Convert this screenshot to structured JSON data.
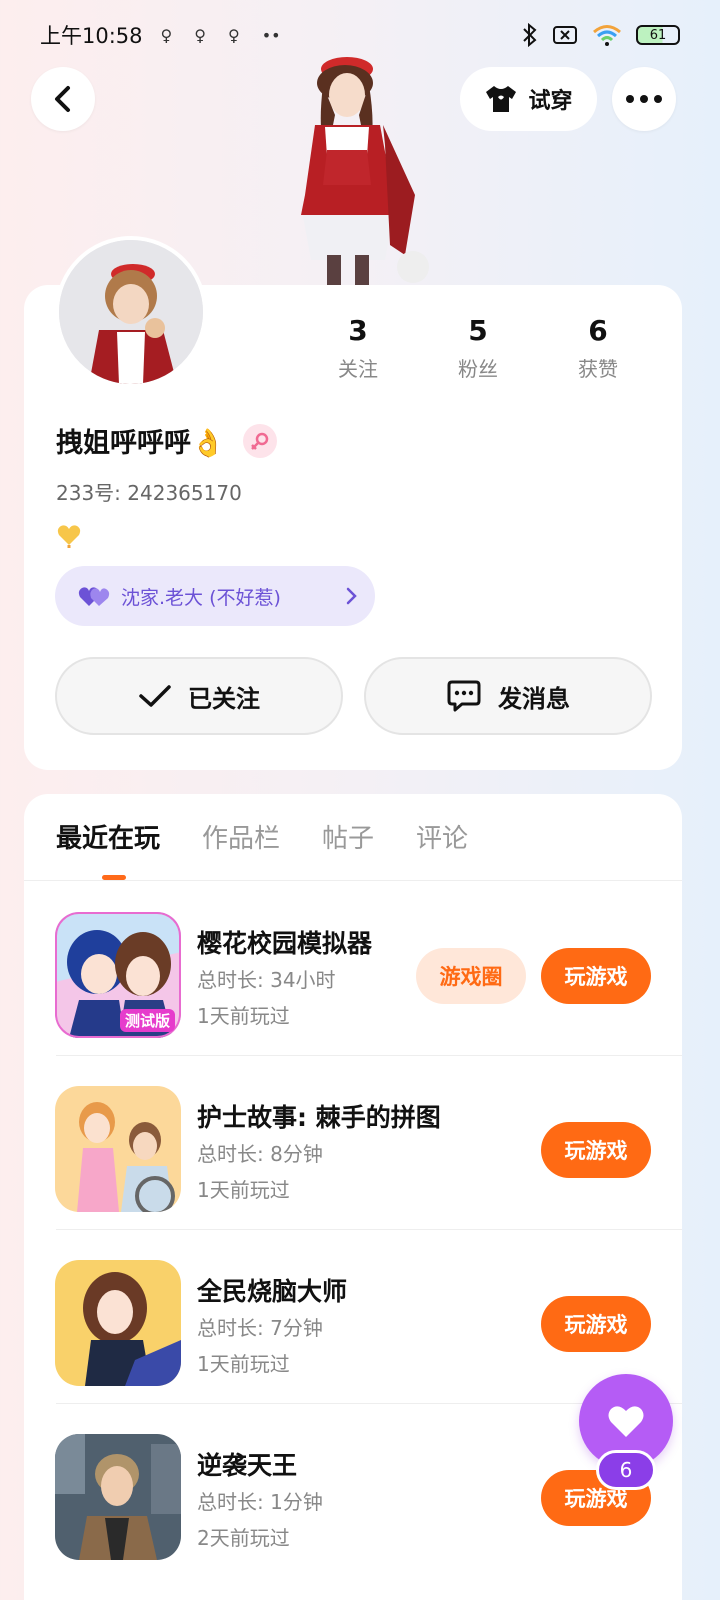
{
  "status_bar": {
    "time": "上午10:58",
    "notif_dots": "••",
    "battery": "61"
  },
  "header": {
    "tryon_label": "试穿"
  },
  "profile": {
    "stats": [
      {
        "count": "3",
        "label": "关注"
      },
      {
        "count": "5",
        "label": "粉丝"
      },
      {
        "count": "6",
        "label": "获赞"
      }
    ],
    "username": "拽姐呼呼呼👌",
    "uid": "233号: 242365170",
    "group_name": "沈家.老大 (不好惹)",
    "follow_label": "已关注",
    "message_label": "发消息"
  },
  "tabs": [
    "最近在玩",
    "作品栏",
    "帖子",
    "评论"
  ],
  "games": [
    {
      "name": "樱花校园模拟器",
      "duration": "总时长: 34小时",
      "last_played": "1天前玩过",
      "circle_label": "游戏圈",
      "play_label": "玩游戏",
      "icon_badge": "测试版"
    },
    {
      "name": "护士故事: 棘手的拼图",
      "duration": "总时长: 8分钟",
      "last_played": "1天前玩过",
      "play_label": "玩游戏"
    },
    {
      "name": "全民烧脑大师",
      "duration": "总时长: 7分钟",
      "last_played": "1天前玩过",
      "play_label": "玩游戏"
    },
    {
      "name": "逆袭天王",
      "duration": "总时长: 1分钟",
      "last_played": "2天前玩过",
      "play_label": "玩游戏"
    }
  ],
  "fab": {
    "count": "6"
  },
  "colors": {
    "accent": "#ff6a14",
    "accent_soft": "#ffe7d9",
    "purple": "#b55cf5",
    "group_pill": "#ebe8fb"
  },
  "icons": {
    "back": "chevron-left-icon",
    "tryon": "tshirt-icon",
    "more": "more-dots-icon",
    "follow": "check-icon",
    "message": "chat-bubble-icon",
    "group": "double-heart-icon",
    "fab": "heart-icon"
  }
}
